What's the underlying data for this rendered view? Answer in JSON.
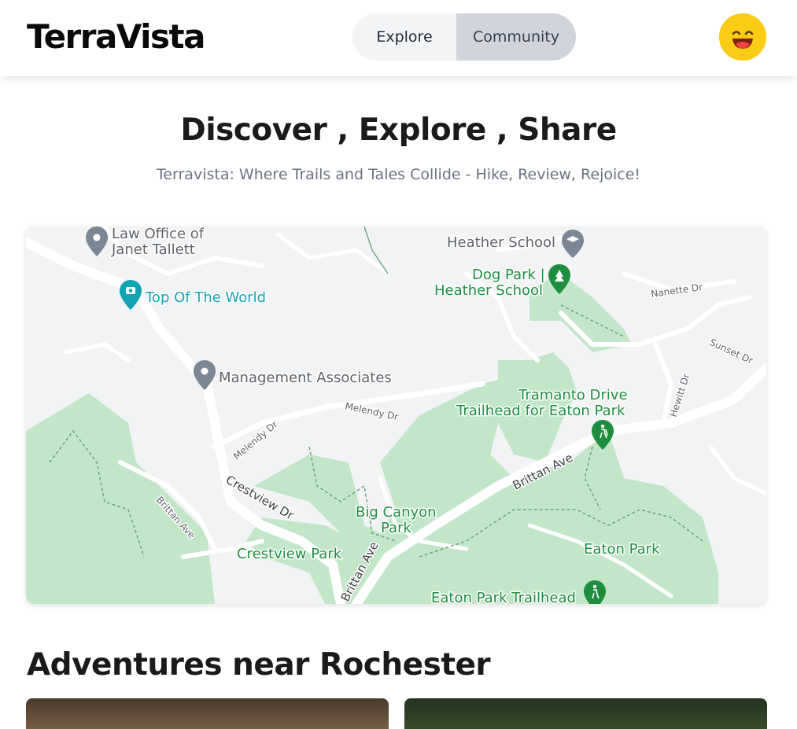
{
  "header": {
    "logo": "TerraVista",
    "nav": [
      {
        "label": "Explore",
        "active": false
      },
      {
        "label": "Community",
        "active": true
      }
    ],
    "avatar_icon": "laughing-emoji-icon"
  },
  "hero": {
    "title": "Discover , Explore , Share",
    "subtitle": "Terravista: Where Trails and Tales Collide - Hike, Review, Rejoice!"
  },
  "map": {
    "places": {
      "law_office_1": "Law Office of",
      "law_office_2": "Janet Tallett",
      "top_of_world": "Top Of The World",
      "heather_school": "Heather School",
      "dog_park_1": "Dog Park |",
      "dog_park_2": "Heather School",
      "management": "Management Associates",
      "tramanto_1": "Tramanto Drive",
      "tramanto_2": "Trailhead for Eaton Park",
      "big_canyon_1": "Big Canyon",
      "big_canyon_2": "Park",
      "crestview_park": "Crestview Park",
      "eaton_park": "Eaton Park",
      "eaton_trailhead": "Eaton Park Trailhead"
    },
    "streets": {
      "nanette": "Nanette Dr",
      "sunset": "Sunset Dr",
      "hewitt": "Hewitt Dr",
      "melendy_1": "Melendy Dr",
      "melendy_2": "Melendy Dr",
      "brittan_1": "Brittan Ave",
      "brittan_2": "Brittan Ave",
      "brittan_3": "Brittan Ave",
      "crestview": "Crestview Dr"
    }
  },
  "section": {
    "title": "Adventures near Rochester"
  },
  "colors": {
    "park_green": "#c3e6c9",
    "poi_green": "#1e8e3e",
    "poi_teal": "#12a4b4",
    "poi_gray": "#7b8794",
    "avatar": "#facc15"
  }
}
